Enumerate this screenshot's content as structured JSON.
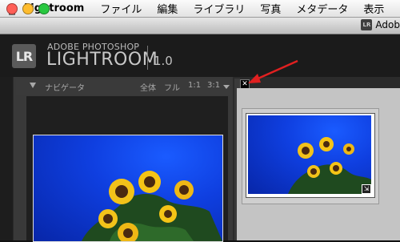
{
  "menubar": {
    "apple_icon": "apple-icon",
    "app": "Lightroom",
    "items": [
      "ファイル",
      "編集",
      "ライブラリ",
      "写真",
      "メタデータ",
      "表示"
    ]
  },
  "window": {
    "title_fragment": "Adob",
    "app_badge": "LR"
  },
  "identity_plate": {
    "badge": "LR",
    "line1": "ADOBE PHOTOSHOP",
    "line2": "LIGHTROOM",
    "version": "1.0"
  },
  "navigator": {
    "title": "ナビゲータ",
    "zoom_options": [
      "全体",
      "フル",
      "1:1",
      "3:1"
    ]
  },
  "colors": {
    "sky": "#0f3fe0",
    "annotation_arrow": "#e02020"
  }
}
